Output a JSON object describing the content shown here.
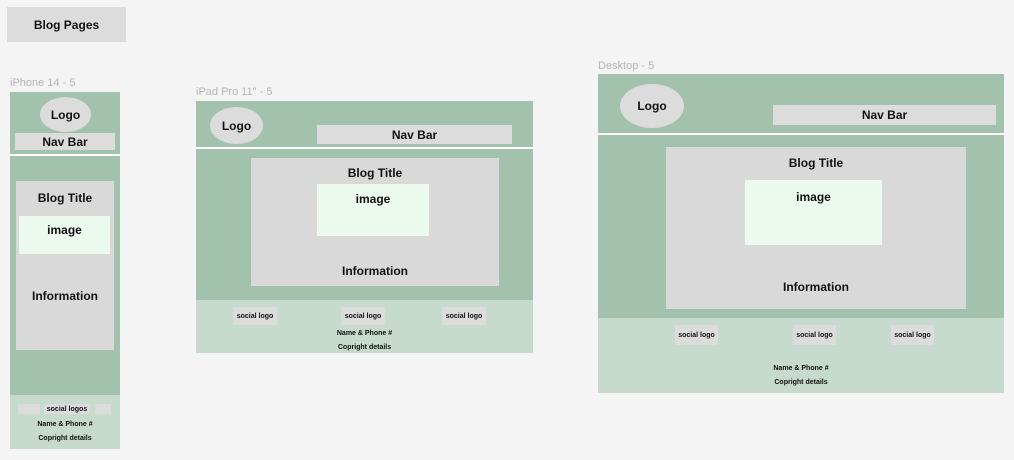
{
  "page_title": "Blog Pages",
  "frames": {
    "iphone": {
      "label": "iPhone 14 - 5",
      "logo": "Logo",
      "nav": "Nav Bar",
      "blog_title": "Blog Title",
      "image": "image",
      "information": "Information",
      "social": "social logos",
      "name_phone": "Name & Phone #",
      "copyright": "Copright details"
    },
    "ipad": {
      "label": "iPad Pro 11\" - 5",
      "logo": "Logo",
      "nav": "Nav Bar",
      "blog_title": "Blog Title",
      "image": "image",
      "information": "Information",
      "social": [
        "social logo",
        "social logo",
        "social logo"
      ],
      "name_phone": "Name & Phone #",
      "copyright": "Copright details"
    },
    "desktop": {
      "label": "Desktop - 5",
      "logo": "Logo",
      "nav": "Nav Bar",
      "blog_title": "Blog Title",
      "image": "image",
      "information": "Information",
      "social": [
        "social logo",
        "social logo",
        "social logo"
      ],
      "name_phone": "Name & Phone #",
      "copyright": "Copright details"
    }
  },
  "colors": {
    "background": "#f4f4f4",
    "frame_green": "#a3c2ae",
    "footer_green": "#c6dacd",
    "placeholder_gray": "#d9d9d9",
    "image_mint": "#ebf9ef"
  }
}
